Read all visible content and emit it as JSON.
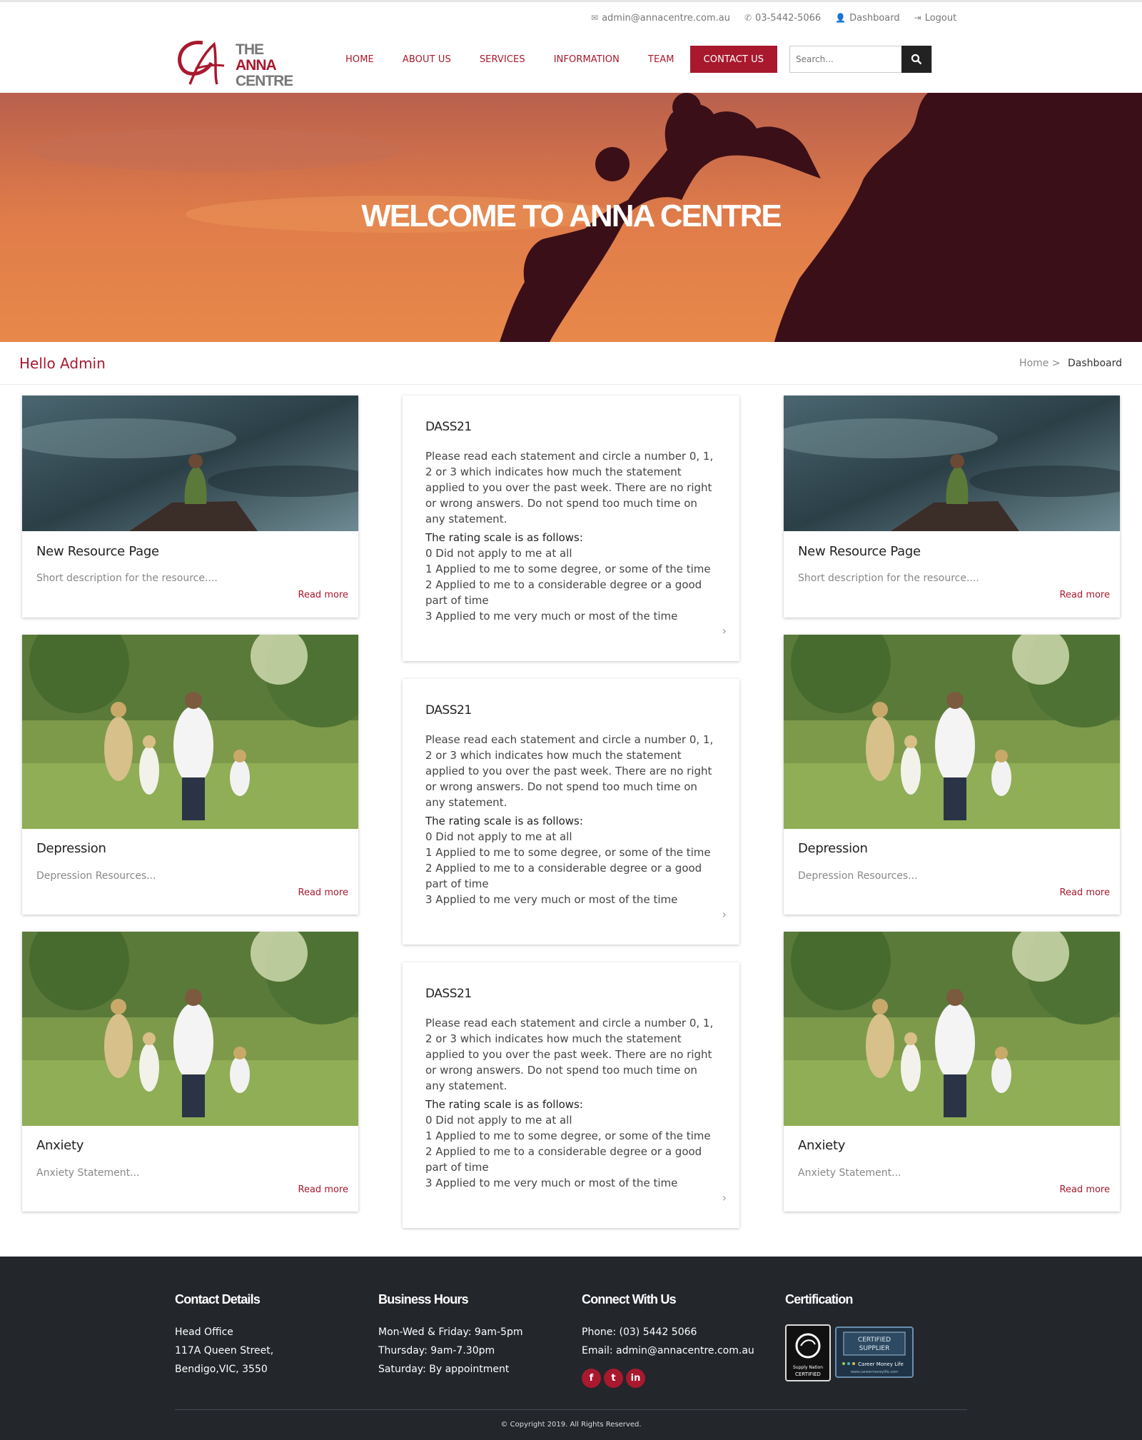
{
  "topbar": {
    "email": "admin@annacentre.com.au",
    "phone": "03-5442-5066",
    "dashboard": "Dashboard",
    "logout": "Logout"
  },
  "logo": {
    "line1": "THE",
    "line2": "ANNA",
    "line3": "CENTRE"
  },
  "nav": {
    "items": [
      {
        "label": "HOME"
      },
      {
        "label": "ABOUT US"
      },
      {
        "label": "SERVICES"
      },
      {
        "label": "INFORMATION"
      },
      {
        "label": "TEAM"
      },
      {
        "label": "CONTACT US"
      }
    ],
    "active": "CONTACT US"
  },
  "search": {
    "placeholder": "Search..."
  },
  "hero": {
    "title": "WELCOME TO ANNA CENTRE"
  },
  "subhead": {
    "greeting": "Hello Admin",
    "breadcrumb_home": "Home >",
    "breadcrumb_current": "Dashboard"
  },
  "cards": {
    "resource": {
      "title": "New Resource Page",
      "desc": "Short description for the resource....",
      "more": "Read more"
    },
    "depression": {
      "title": "Depression",
      "desc": "Depression Resources...",
      "more": "Read more"
    },
    "anxiety": {
      "title": "Anxiety",
      "desc": "Anxiety Statement...",
      "more": "Read more"
    }
  },
  "dass": {
    "title": "DASS21",
    "intro": "Please read each statement and circle a number 0, 1, 2 or 3 which indicates how much the statement applied to you over the past week. There are no right or wrong answers. Do not spend too much time on any statement.",
    "scale_heading": "The rating scale is as follows:",
    "s0": "0 Did not apply to me at all",
    "s1": "1  Applied to me to some degree, or some of the time",
    "s2": "2  Applied to me to a considerable degree or a good part of time",
    "s3": "3  Applied to me very much or most of the time"
  },
  "footer": {
    "contact": {
      "heading": "Contact Details",
      "l1": "Head Office",
      "l2": "117A Queen Street,",
      "l3": "Bendigo,VIC, 3550"
    },
    "hours": {
      "heading": "Business Hours",
      "l1": "Mon-Wed & Friday: 9am-5pm",
      "l2": "Thursday: 9am-7.30pm",
      "l3": "Saturday: By appointment"
    },
    "connect": {
      "heading": "Connect With Us",
      "phone": "Phone: (03) 5442 5066",
      "email": "Email: admin@annacentre.com.au",
      "fb": "f",
      "tw": "t",
      "li": "in"
    },
    "cert": {
      "heading": "Certification",
      "badge1a": "Supply Nation",
      "badge1b": "CERTIFIED",
      "badge2a": "CERTIFIED",
      "badge2b": "SUPPLIER",
      "badge2c": "Career Money Life",
      "badge2d": "www.careermoneylife.com"
    },
    "copyright": "© Copyright 2019. All Rights Reserved."
  },
  "colors": {
    "brand": "#a8192e",
    "footer_bg": "#23262b"
  }
}
